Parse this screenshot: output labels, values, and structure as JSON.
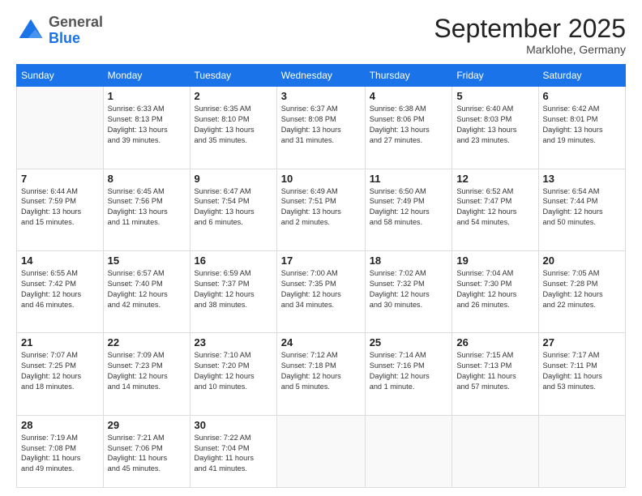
{
  "logo": {
    "general": "General",
    "blue": "Blue"
  },
  "header": {
    "month": "September 2025",
    "location": "Marklohe, Germany"
  },
  "weekdays": [
    "Sunday",
    "Monday",
    "Tuesday",
    "Wednesday",
    "Thursday",
    "Friday",
    "Saturday"
  ],
  "weeks": [
    [
      {
        "day": "",
        "info": ""
      },
      {
        "day": "1",
        "info": "Sunrise: 6:33 AM\nSunset: 8:13 PM\nDaylight: 13 hours\nand 39 minutes."
      },
      {
        "day": "2",
        "info": "Sunrise: 6:35 AM\nSunset: 8:10 PM\nDaylight: 13 hours\nand 35 minutes."
      },
      {
        "day": "3",
        "info": "Sunrise: 6:37 AM\nSunset: 8:08 PM\nDaylight: 13 hours\nand 31 minutes."
      },
      {
        "day": "4",
        "info": "Sunrise: 6:38 AM\nSunset: 8:06 PM\nDaylight: 13 hours\nand 27 minutes."
      },
      {
        "day": "5",
        "info": "Sunrise: 6:40 AM\nSunset: 8:03 PM\nDaylight: 13 hours\nand 23 minutes."
      },
      {
        "day": "6",
        "info": "Sunrise: 6:42 AM\nSunset: 8:01 PM\nDaylight: 13 hours\nand 19 minutes."
      }
    ],
    [
      {
        "day": "7",
        "info": "Sunrise: 6:44 AM\nSunset: 7:59 PM\nDaylight: 13 hours\nand 15 minutes."
      },
      {
        "day": "8",
        "info": "Sunrise: 6:45 AM\nSunset: 7:56 PM\nDaylight: 13 hours\nand 11 minutes."
      },
      {
        "day": "9",
        "info": "Sunrise: 6:47 AM\nSunset: 7:54 PM\nDaylight: 13 hours\nand 6 minutes."
      },
      {
        "day": "10",
        "info": "Sunrise: 6:49 AM\nSunset: 7:51 PM\nDaylight: 13 hours\nand 2 minutes."
      },
      {
        "day": "11",
        "info": "Sunrise: 6:50 AM\nSunset: 7:49 PM\nDaylight: 12 hours\nand 58 minutes."
      },
      {
        "day": "12",
        "info": "Sunrise: 6:52 AM\nSunset: 7:47 PM\nDaylight: 12 hours\nand 54 minutes."
      },
      {
        "day": "13",
        "info": "Sunrise: 6:54 AM\nSunset: 7:44 PM\nDaylight: 12 hours\nand 50 minutes."
      }
    ],
    [
      {
        "day": "14",
        "info": "Sunrise: 6:55 AM\nSunset: 7:42 PM\nDaylight: 12 hours\nand 46 minutes."
      },
      {
        "day": "15",
        "info": "Sunrise: 6:57 AM\nSunset: 7:40 PM\nDaylight: 12 hours\nand 42 minutes."
      },
      {
        "day": "16",
        "info": "Sunrise: 6:59 AM\nSunset: 7:37 PM\nDaylight: 12 hours\nand 38 minutes."
      },
      {
        "day": "17",
        "info": "Sunrise: 7:00 AM\nSunset: 7:35 PM\nDaylight: 12 hours\nand 34 minutes."
      },
      {
        "day": "18",
        "info": "Sunrise: 7:02 AM\nSunset: 7:32 PM\nDaylight: 12 hours\nand 30 minutes."
      },
      {
        "day": "19",
        "info": "Sunrise: 7:04 AM\nSunset: 7:30 PM\nDaylight: 12 hours\nand 26 minutes."
      },
      {
        "day": "20",
        "info": "Sunrise: 7:05 AM\nSunset: 7:28 PM\nDaylight: 12 hours\nand 22 minutes."
      }
    ],
    [
      {
        "day": "21",
        "info": "Sunrise: 7:07 AM\nSunset: 7:25 PM\nDaylight: 12 hours\nand 18 minutes."
      },
      {
        "day": "22",
        "info": "Sunrise: 7:09 AM\nSunset: 7:23 PM\nDaylight: 12 hours\nand 14 minutes."
      },
      {
        "day": "23",
        "info": "Sunrise: 7:10 AM\nSunset: 7:20 PM\nDaylight: 12 hours\nand 10 minutes."
      },
      {
        "day": "24",
        "info": "Sunrise: 7:12 AM\nSunset: 7:18 PM\nDaylight: 12 hours\nand 5 minutes."
      },
      {
        "day": "25",
        "info": "Sunrise: 7:14 AM\nSunset: 7:16 PM\nDaylight: 12 hours\nand 1 minute."
      },
      {
        "day": "26",
        "info": "Sunrise: 7:15 AM\nSunset: 7:13 PM\nDaylight: 11 hours\nand 57 minutes."
      },
      {
        "day": "27",
        "info": "Sunrise: 7:17 AM\nSunset: 7:11 PM\nDaylight: 11 hours\nand 53 minutes."
      }
    ],
    [
      {
        "day": "28",
        "info": "Sunrise: 7:19 AM\nSunset: 7:08 PM\nDaylight: 11 hours\nand 49 minutes."
      },
      {
        "day": "29",
        "info": "Sunrise: 7:21 AM\nSunset: 7:06 PM\nDaylight: 11 hours\nand 45 minutes."
      },
      {
        "day": "30",
        "info": "Sunrise: 7:22 AM\nSunset: 7:04 PM\nDaylight: 11 hours\nand 41 minutes."
      },
      {
        "day": "",
        "info": ""
      },
      {
        "day": "",
        "info": ""
      },
      {
        "day": "",
        "info": ""
      },
      {
        "day": "",
        "info": ""
      }
    ]
  ]
}
